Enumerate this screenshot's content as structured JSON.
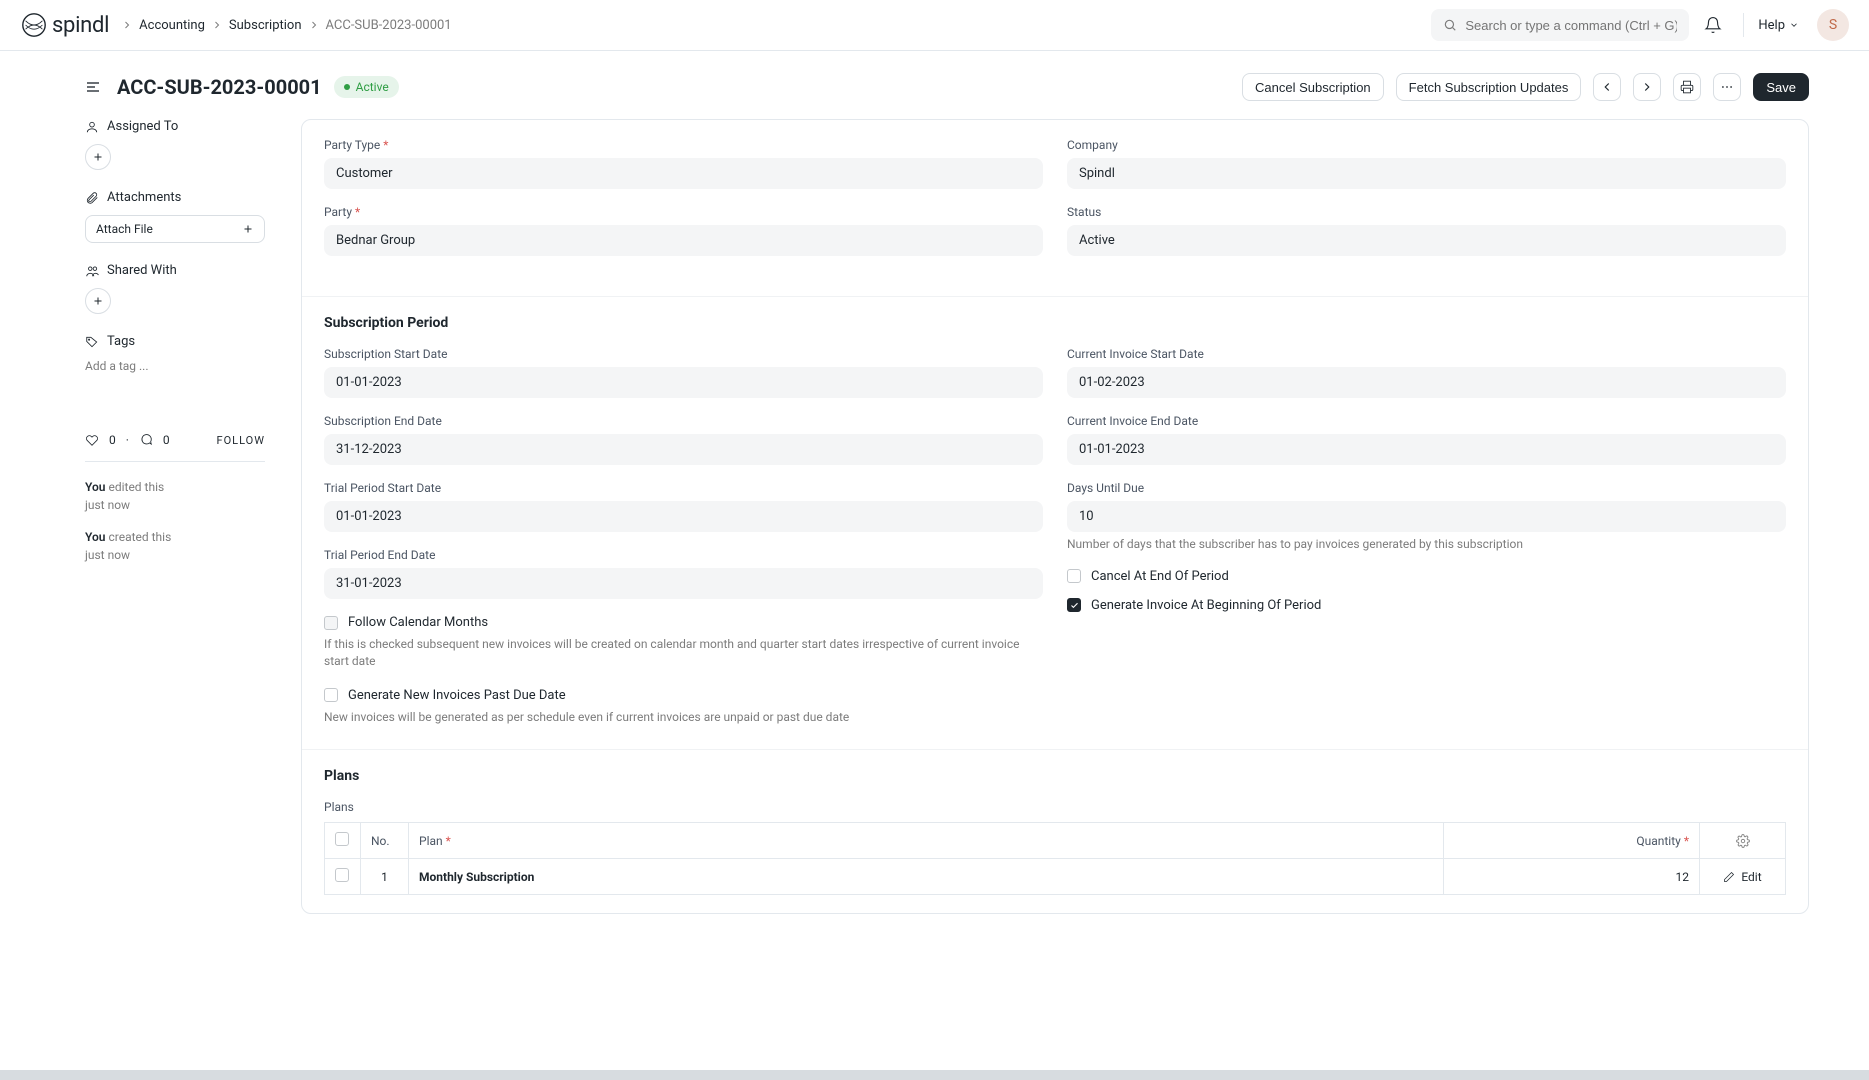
{
  "brand": "spindl",
  "breadcrumb": {
    "items": [
      "Accounting",
      "Subscription"
    ],
    "current": "ACC-SUB-2023-00001"
  },
  "search_placeholder": "Search or type a command (Ctrl + G)",
  "help_label": "Help",
  "avatar_initial": "S",
  "page": {
    "title": "ACC-SUB-2023-00001",
    "status": "Active",
    "actions": {
      "cancel": "Cancel Subscription",
      "fetch": "Fetch Subscription Updates",
      "save": "Save"
    }
  },
  "sidebar": {
    "assigned_to": "Assigned To",
    "attachments": "Attachments",
    "attach_file": "Attach File",
    "shared_with": "Shared With",
    "tags": "Tags",
    "tags_placeholder": "Add a tag ...",
    "likes": "0",
    "comments": "0",
    "follow": "FOLLOW",
    "activity": [
      {
        "who": "You",
        "what": "edited this",
        "when": "just now"
      },
      {
        "who": "You",
        "what": "created this",
        "when": "just now"
      }
    ]
  },
  "form": {
    "party_type_label": "Party Type",
    "party_type": "Customer",
    "party_label": "Party",
    "party": "Bednar Group",
    "company_label": "Company",
    "company": "Spindl",
    "status_label": "Status",
    "status": "Active"
  },
  "subscription": {
    "heading": "Subscription Period",
    "start_label": "Subscription Start Date",
    "start": "01-01-2023",
    "end_label": "Subscription End Date",
    "end": "31-12-2023",
    "trial_start_label": "Trial Period Start Date",
    "trial_start": "01-01-2023",
    "trial_end_label": "Trial Period End Date",
    "trial_end": "31-01-2023",
    "follow_cal_label": "Follow Calendar Months",
    "follow_cal_help": "If this is checked subsequent new invoices will be created on calendar month and quarter start dates irrespective of current invoice start date",
    "gen_past_label": "Generate New Invoices Past Due Date",
    "gen_past_help": "New invoices will be generated as per schedule even if current invoices are unpaid or past due date",
    "curr_inv_start_label": "Current Invoice Start Date",
    "curr_inv_start": "01-02-2023",
    "curr_inv_end_label": "Current Invoice End Date",
    "curr_inv_end": "01-01-2023",
    "days_due_label": "Days Until Due",
    "days_due": "10",
    "days_due_help": "Number of days that the subscriber has to pay invoices generated by this subscription",
    "cancel_end_label": "Cancel At End Of Period",
    "gen_begin_label": "Generate Invoice At Beginning Of Period"
  },
  "plans": {
    "heading": "Plans",
    "table_label": "Plans",
    "cols": {
      "no": "No.",
      "plan": "Plan",
      "qty": "Quantity"
    },
    "rows": [
      {
        "no": "1",
        "plan": "Monthly Subscription",
        "qty": "12",
        "edit": "Edit"
      }
    ]
  }
}
